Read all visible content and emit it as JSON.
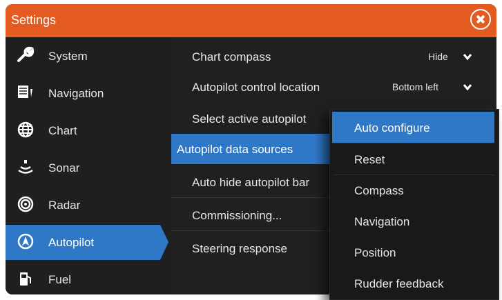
{
  "window": {
    "title": "Settings"
  },
  "sidebar": {
    "items": [
      {
        "label": "System",
        "icon": "wrench-icon"
      },
      {
        "label": "Navigation",
        "icon": "navigation-icon"
      },
      {
        "label": "Chart",
        "icon": "globe-icon"
      },
      {
        "label": "Sonar",
        "icon": "sonar-icon"
      },
      {
        "label": "Radar",
        "icon": "radar-icon"
      },
      {
        "label": "Autopilot",
        "icon": "autopilot-icon",
        "selected": true
      },
      {
        "label": "Fuel",
        "icon": "fuel-pump-icon"
      }
    ]
  },
  "settings": {
    "rows": [
      {
        "label": "Chart compass",
        "value": "Hide"
      },
      {
        "label": "Autopilot control location",
        "value": "Bottom left"
      },
      {
        "label": "Select active autopilot"
      },
      {
        "label": "Autopilot data sources",
        "selected": true
      },
      {
        "label": "Auto hide autopilot bar"
      },
      {
        "label": "Commissioning..."
      },
      {
        "label": "Steering response"
      }
    ]
  },
  "dropdown": {
    "items": [
      {
        "label": "Auto configure",
        "selected": true
      },
      {
        "label": "Reset"
      },
      {
        "label": "Compass"
      },
      {
        "label": "Navigation"
      },
      {
        "label": "Position"
      },
      {
        "label": "Rudder feedback"
      }
    ]
  },
  "colors": {
    "titlebar": "#e45b22",
    "accent": "#2f78c7",
    "background": "#1f1f1f"
  }
}
